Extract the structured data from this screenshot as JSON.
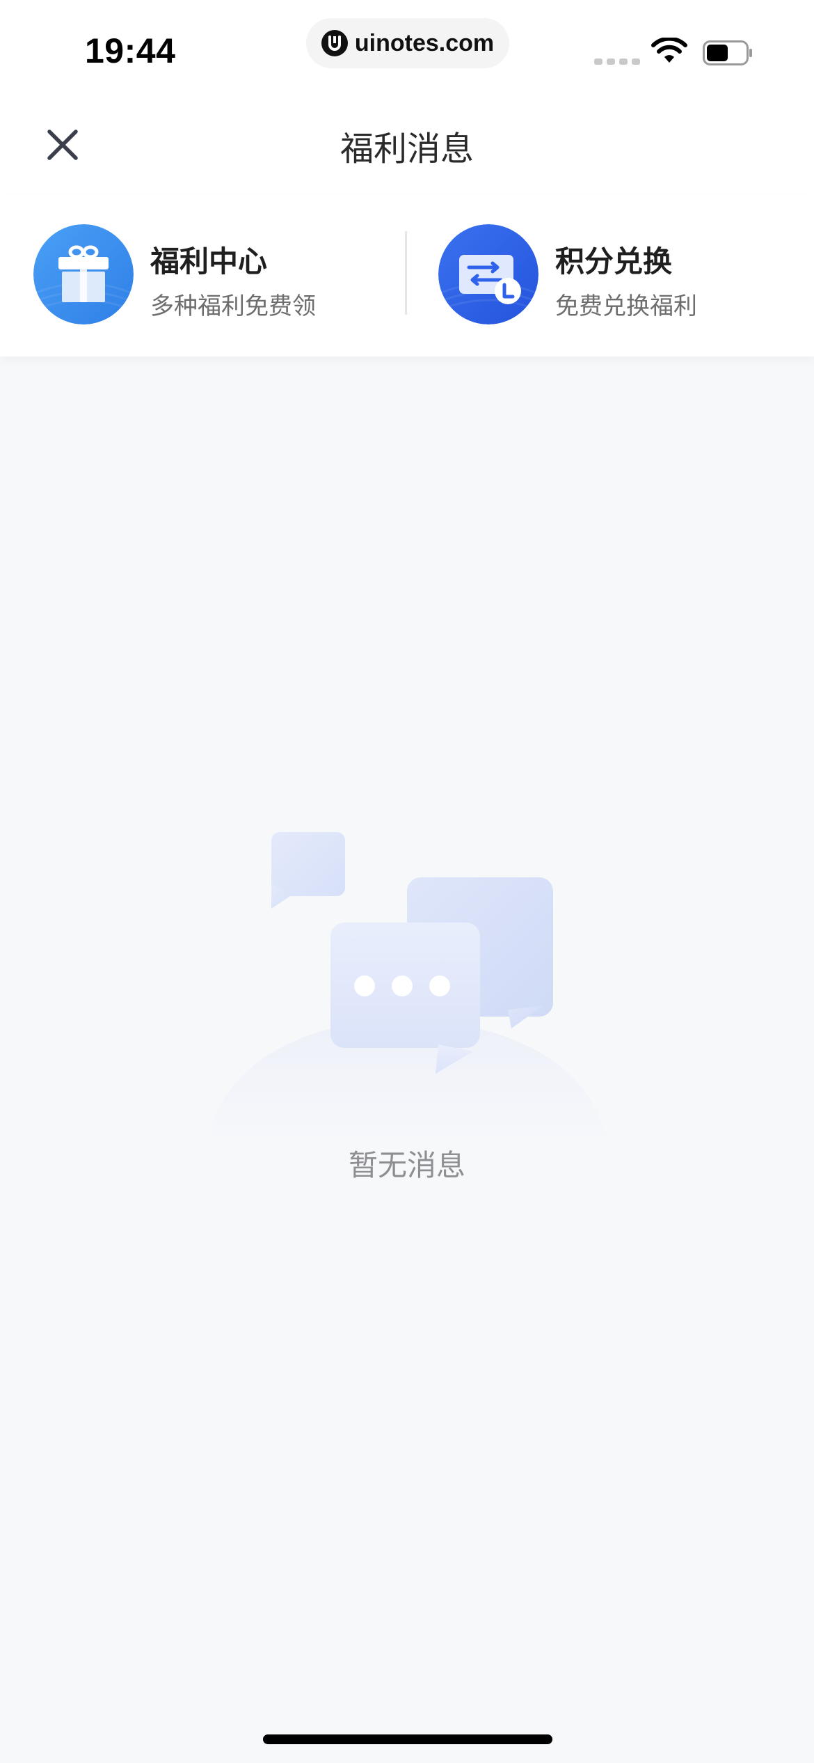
{
  "status_bar": {
    "time": "19:44",
    "url": "uinotes.com",
    "icons": [
      "cellular-dots-icon",
      "wifi-icon",
      "battery-icon"
    ]
  },
  "nav": {
    "title": "福利消息",
    "close_icon": "close-icon"
  },
  "shortcuts": [
    {
      "title": "福利中心",
      "subtitle": "多种福利免费领",
      "icon": "gift-icon",
      "color": "#3d8ff0"
    },
    {
      "title": "积分兑换",
      "subtitle": "免费兑换福利",
      "icon": "exchange-ticket-icon",
      "color": "#2f62ea"
    }
  ],
  "empty_state": {
    "text": "暂无消息",
    "icon": "chat-bubbles-icon"
  },
  "colors": {
    "background": "#f7f8fa",
    "surface": "#ffffff",
    "gift_blue": "#3d8ff0",
    "exchange_blue": "#2f62ea",
    "muted_text": "#8e8e93"
  }
}
